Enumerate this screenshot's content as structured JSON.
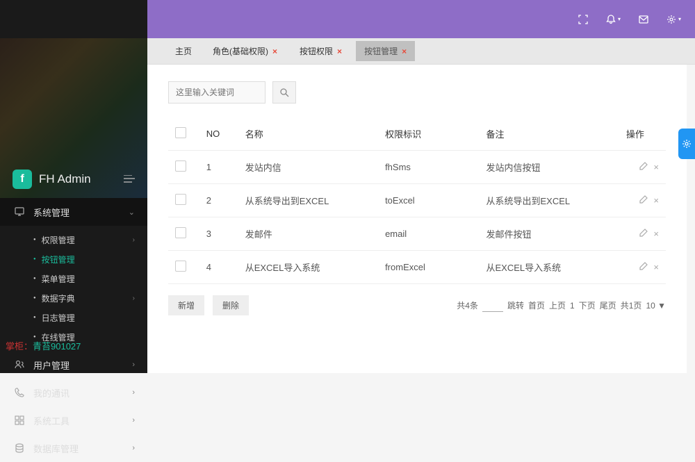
{
  "brand": {
    "title": "FH Admin",
    "logo_letter": "f"
  },
  "sidebar": {
    "sections": [
      {
        "icon": "monitor",
        "label": "系统管理",
        "expanded": true
      },
      {
        "icon": "users",
        "label": "用户管理",
        "expanded": false
      },
      {
        "icon": "phone",
        "label": "我的通讯",
        "expanded": false
      },
      {
        "icon": "grid",
        "label": "系统工具",
        "expanded": false
      },
      {
        "icon": "database",
        "label": "数据库管理",
        "expanded": false
      }
    ],
    "subitems": [
      {
        "label": "权限管理",
        "has_children": true
      },
      {
        "label": "按钮管理",
        "active": true
      },
      {
        "label": "菜单管理"
      },
      {
        "label": "数据字典",
        "has_children": true
      },
      {
        "label": "日志管理"
      },
      {
        "label": "在线管理"
      }
    ],
    "footer": {
      "prefix": "掌柜：",
      "value": "青苔901027"
    }
  },
  "tabs": [
    {
      "label": "主页",
      "closable": false
    },
    {
      "label": "角色(基础权限)",
      "closable": true
    },
    {
      "label": "按钮权限",
      "closable": true
    },
    {
      "label": "按钮管理",
      "closable": true,
      "active": true
    }
  ],
  "search": {
    "placeholder": "这里输入关键词"
  },
  "table": {
    "headers": {
      "no": "NO",
      "name": "名称",
      "perm": "权限标识",
      "remark": "备注",
      "ops": "操作"
    },
    "rows": [
      {
        "no": "1",
        "name": "发站内信",
        "perm": "fhSms",
        "remark": "发站内信按钮"
      },
      {
        "no": "2",
        "name": "从系统导出到EXCEL",
        "perm": "toExcel",
        "remark": "从系统导出到EXCEL"
      },
      {
        "no": "3",
        "name": "发邮件",
        "perm": "email",
        "remark": "发邮件按钮"
      },
      {
        "no": "4",
        "name": "从EXCEL导入系统",
        "perm": "fromExcel",
        "remark": "从EXCEL导入系统"
      }
    ]
  },
  "actions": {
    "add": "新增",
    "delete": "删除"
  },
  "pager": {
    "total_label": "共4条",
    "jump": "跳转",
    "first": "首页",
    "prev": "上页",
    "current": "1",
    "next": "下页",
    "last": "尾页",
    "pages_label": "共1页",
    "pagesize": "10 ▼"
  }
}
